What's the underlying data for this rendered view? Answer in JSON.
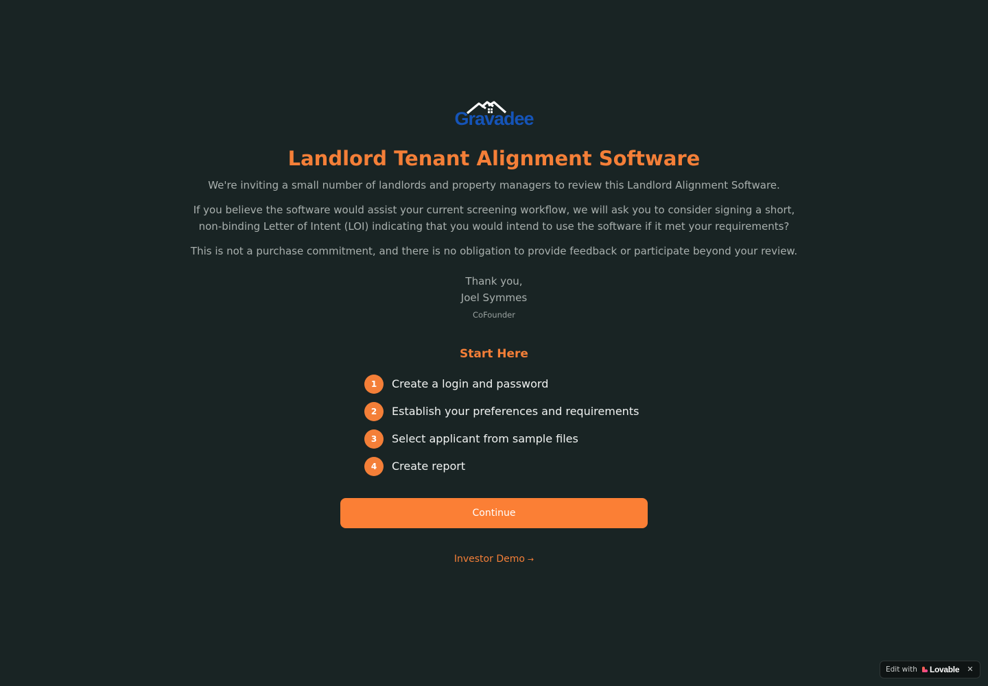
{
  "brand": {
    "logo_text": "Gravadee",
    "logo_icon": "house-roof-icon"
  },
  "header": {
    "title": "Landlord Tenant Alignment Software"
  },
  "intro": {
    "paragraph_1": "We're inviting a small number of landlords and property managers to review this Landlord Alignment Software.",
    "paragraph_2": "If you believe the software would assist your current screening workflow, we will ask you to consider signing a short, non-binding Letter of Intent (LOI) indicating that you would intend to use the software if it met your requirements?",
    "paragraph_3": "This is not a purchase commitment, and there is no obligation to provide feedback or participate beyond your review."
  },
  "signoff": {
    "thanks": "Thank you,",
    "name": "Joel Symmes",
    "role": "CoFounder"
  },
  "start": {
    "title": "Start Here",
    "steps": [
      {
        "number": "1",
        "label": "Create a login and password"
      },
      {
        "number": "2",
        "label": "Establish your preferences and requirements"
      },
      {
        "number": "3",
        "label": "Select applicant from sample files"
      },
      {
        "number": "4",
        "label": "Create report"
      }
    ]
  },
  "actions": {
    "continue_label": "Continue",
    "investor_demo_label": "Investor Demo",
    "investor_demo_arrow": "→"
  },
  "badge": {
    "edit_label": "Edit with",
    "brand_label": "Lovable",
    "close_label": "✕"
  },
  "colors": {
    "background": "#192424",
    "accent": "#f47f38",
    "logo_blue": "#1554b8"
  }
}
